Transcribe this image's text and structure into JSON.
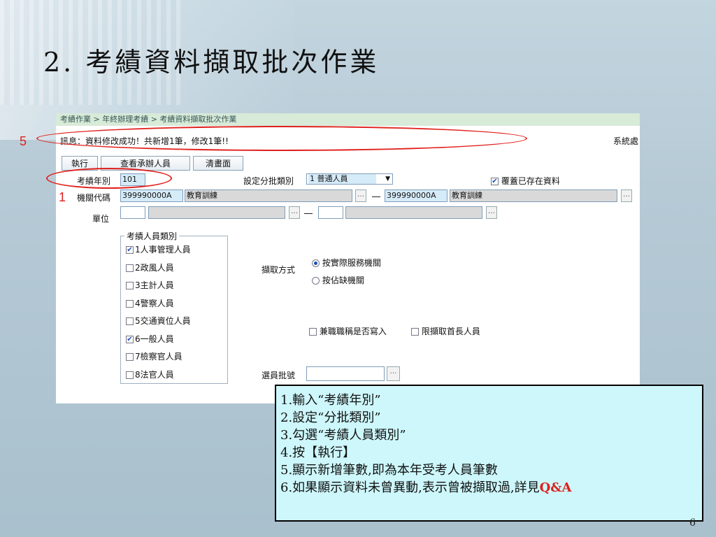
{
  "slide": {
    "title": "2. 考績資料擷取批次作業",
    "page_number": "6"
  },
  "breadcrumb": "考績作業 > 年終辦理考績 > 考績資料擷取批次作業",
  "message": "訊息：資料修改成功！共新增1筆，修改1筆!!",
  "system_label": "系統處",
  "buttons": {
    "execute": "執行",
    "view_staff": "查看承辦人員",
    "clear": "清畫面"
  },
  "form": {
    "year_label": "考績年別",
    "year_value": "101",
    "batch_label": "設定分批類別",
    "batch_value": "1 普通人員",
    "overwrite_label": "覆蓋已存在資料",
    "agency_label": "機關代碼",
    "agency_code_from": "399990000A",
    "agency_name_from": "教育訓練",
    "agency_code_to": "399990000A",
    "agency_name_to": "教育訓練",
    "unit_label": "單位",
    "method_label": "擷取方式",
    "method_options": [
      "按實際服務機關",
      "按佔缺機關"
    ],
    "concurrent_label": "兼職職稱是否寫入",
    "head_only_label": "限擷取首長人員",
    "selector_label": "選員批號"
  },
  "categories": {
    "legend": "考績人員類別",
    "items": [
      {
        "label": "1人事管理人員",
        "checked": true
      },
      {
        "label": "2政風人員",
        "checked": false
      },
      {
        "label": "3主計人員",
        "checked": false
      },
      {
        "label": "4警察人員",
        "checked": false
      },
      {
        "label": "5交通資位人員",
        "checked": false
      },
      {
        "label": "6一般人員",
        "checked": true
      },
      {
        "label": "7檢察官人員",
        "checked": false
      },
      {
        "label": "8法官人員",
        "checked": false
      }
    ]
  },
  "annotations": {
    "five": "5",
    "one": "1"
  },
  "notes": {
    "line1": "1.輸入“考績年別”",
    "line2": "2.設定“分批類別”",
    "line3": "3.勾選“考績人員類別”",
    "line4": "4.按【執行】",
    "line5": "5.顯示新增筆數,即為本年受考人員筆數",
    "line6": "6.如果顯示資料未曾異動,表示曾被擷取過,詳見",
    "qa": "Q&A"
  },
  "colors": {
    "annotation_red": "#e0201c",
    "note_bg": "#cdf7fb",
    "breadcrumb_bg": "#d8ead8"
  }
}
